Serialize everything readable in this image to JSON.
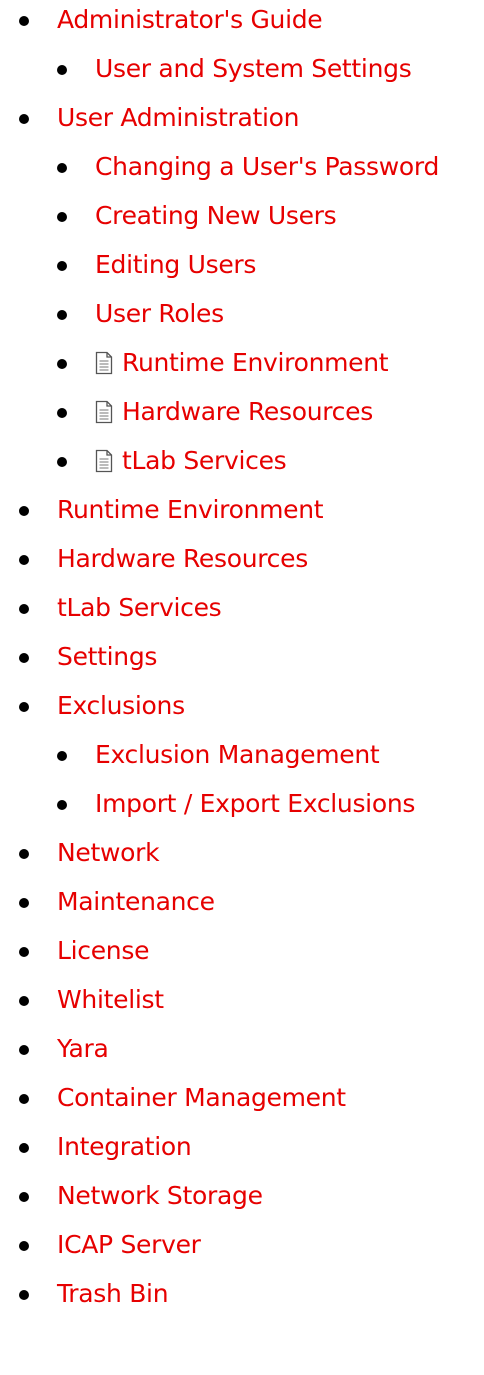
{
  "nav": {
    "items": [
      {
        "label": "Administrator's Guide",
        "level": 1,
        "icon": null
      },
      {
        "label": "User and System Settings",
        "level": 2,
        "icon": null
      },
      {
        "label": "User Administration",
        "level": 1,
        "icon": null
      },
      {
        "label": "Changing a User's Password",
        "level": 2,
        "icon": null
      },
      {
        "label": "Creating New Users",
        "level": 2,
        "icon": null
      },
      {
        "label": "Editing Users",
        "level": 2,
        "icon": null
      },
      {
        "label": "User Roles",
        "level": 2,
        "icon": null
      },
      {
        "label": "Runtime Environment",
        "level": 2,
        "icon": "document-icon"
      },
      {
        "label": "Hardware Resources",
        "level": 2,
        "icon": "document-icon"
      },
      {
        "label": "tLab Services",
        "level": 2,
        "icon": "document-icon"
      },
      {
        "label": "Runtime Environment",
        "level": 1,
        "icon": null
      },
      {
        "label": "Hardware Resources",
        "level": 1,
        "icon": null
      },
      {
        "label": "tLab Services",
        "level": 1,
        "icon": null
      },
      {
        "label": "Settings",
        "level": 1,
        "icon": null
      },
      {
        "label": "Exclusions",
        "level": 1,
        "icon": null
      },
      {
        "label": "Exclusion Management",
        "level": 2,
        "icon": null
      },
      {
        "label": "Import / Export Exclusions",
        "level": 2,
        "icon": null
      },
      {
        "label": "Network",
        "level": 1,
        "icon": null
      },
      {
        "label": "Maintenance",
        "level": 1,
        "icon": null
      },
      {
        "label": "License",
        "level": 1,
        "icon": null
      },
      {
        "label": "Whitelist",
        "level": 1,
        "icon": null
      },
      {
        "label": "Yara",
        "level": 1,
        "icon": null
      },
      {
        "label": "Container Management",
        "level": 1,
        "icon": null
      },
      {
        "label": "Integration",
        "level": 1,
        "icon": null
      },
      {
        "label": "Network Storage",
        "level": 1,
        "icon": null
      },
      {
        "label": "ICAP Server",
        "level": 1,
        "icon": null
      },
      {
        "label": "Trash Bin",
        "level": 1,
        "icon": null
      }
    ]
  },
  "colors": {
    "link": "#e60000",
    "bullet": "#000000",
    "background": "#ffffff"
  }
}
